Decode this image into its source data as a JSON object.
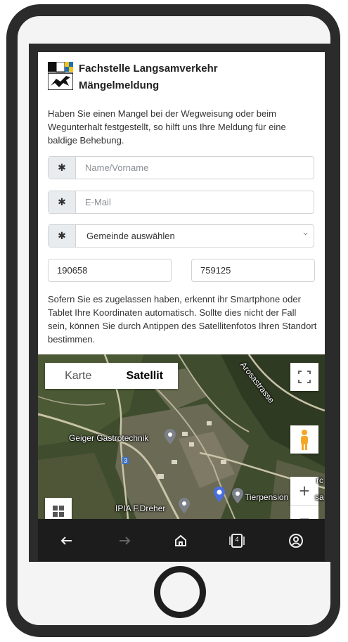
{
  "header": {
    "org_name": "Fachstelle Langsamverkehr",
    "form_title": "Mängelmeldung"
  },
  "intro_text": "Haben Sie einen Mangel bei der Wegweisung oder beim Wegunterhalt festgestellt, so hilft uns Ihre Meldung für eine baldige Behebung.",
  "form": {
    "required_symbol": "✱",
    "name_placeholder": "Name/Vorname",
    "email_placeholder": "E-Mail",
    "municipality_select": "Gemeinde auswählen",
    "coord_x": "190658",
    "coord_y": "759125"
  },
  "location_note": "Sofern Sie es zugelassen haben, erkennt ihr Smartphone oder Tablet Ihre Koordinaten automatisch. Sollte dies nicht der Fall sein, können Sie durch Antippen des Satellitenfotos Ihren Standort bestimmen.",
  "map": {
    "type_options": [
      "Karte",
      "Satellit"
    ],
    "selected_type": "Satellit",
    "zoom_in_label": "+",
    "zoom_out_label": "−",
    "labels": {
      "street": "Arosastrasse",
      "place1": "Geiger Gastrotechnik",
      "place2": "IPIA F.Dreher",
      "place3": "Tierpension",
      "place3_tail": "sa",
      "place4_tail": "rc",
      "route": "3"
    }
  },
  "system_nav": {
    "icons": [
      "back-arrow-icon",
      "forward-arrow-icon",
      "home-icon",
      "tabs-icon",
      "account-icon"
    ],
    "tab_count": "4"
  },
  "colors": {
    "frame": "#2b2b2b",
    "flag_blue": "#1f6fb5",
    "flag_yellow": "#f3c318",
    "peg_orange": "#f4a724",
    "pin_blue": "#4a6ee0"
  }
}
